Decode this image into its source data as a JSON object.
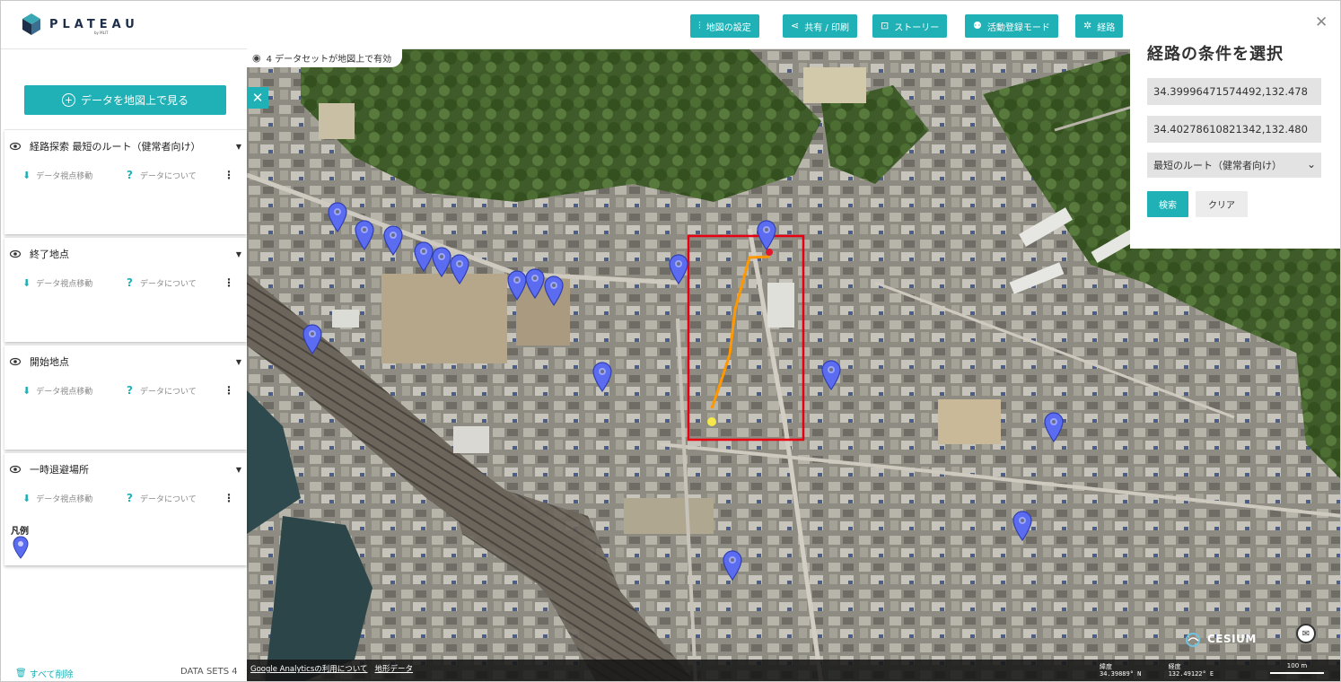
{
  "app": {
    "logo_text": "PLATEAU",
    "logo_sub": "by MLIT"
  },
  "toolbar": {
    "map_settings": "地図の設定",
    "share_print": "共有 / 印刷",
    "story": "ストーリー",
    "activity_mode": "活動登録モード",
    "route": "経路"
  },
  "left_panel": {
    "add_data_label": "データを地図上で見る",
    "datasets": [
      {
        "title": "経路探索 最短のルート（健常者向け）",
        "action_move": "データ視点移動",
        "action_about": "データについて"
      },
      {
        "title": "終了地点",
        "action_move": "データ視点移動",
        "action_about": "データについて"
      },
      {
        "title": "開始地点",
        "action_move": "データ視点移動",
        "action_about": "データについて"
      },
      {
        "title": "一時退避場所",
        "action_move": "データ視点移動",
        "action_about": "データについて"
      }
    ],
    "legend_title": "凡例",
    "delete_all": "すべて削除",
    "datasets_count": "DATA SETS 4"
  },
  "map": {
    "active_datasets": "4 データセットが地図上で有効",
    "footer_links": [
      "Google Analyticsの利用について",
      "地形データ"
    ],
    "lat_label": "緯度",
    "lat_value": "34.39889° N",
    "lon_label": "経度",
    "lon_value": "132.49122° E",
    "scale_label": "100 m",
    "attribution": "CESIUM",
    "marker_color": "#5b6cf0",
    "route_color": "#ff9800",
    "highlight_color": "#e60012"
  },
  "route_panel": {
    "title": "経路の条件を選択",
    "start_value": "34.39996471574492,132.478",
    "end_value": "34.40278610821342,132.480",
    "route_type": "最短のルート（健常者向け）",
    "search_label": "検索",
    "clear_label": "クリア"
  }
}
